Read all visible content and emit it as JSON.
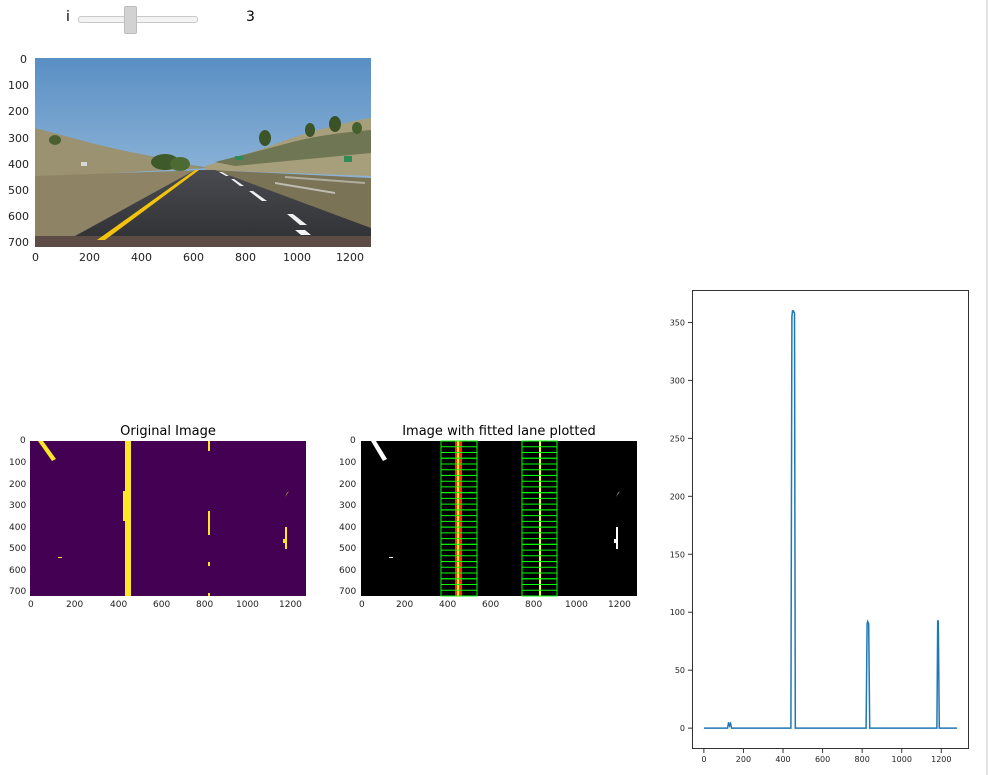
{
  "widget": {
    "label": "i",
    "value": "3"
  },
  "figure1": {
    "xticks": [
      "0",
      "200",
      "400",
      "600",
      "800",
      "1000",
      "1200"
    ],
    "yticks": [
      "0",
      "100",
      "200",
      "300",
      "400",
      "500",
      "600",
      "700"
    ]
  },
  "figure2": {
    "left_title": "Original Image",
    "right_title": "Image with fitted lane plotted",
    "xticks": [
      "0",
      "200",
      "400",
      "600",
      "800",
      "1000",
      "1200"
    ],
    "yticks": [
      "0",
      "100",
      "200",
      "300",
      "400",
      "500",
      "600",
      "700"
    ]
  },
  "chart_data": {
    "type": "line",
    "title": "",
    "xlabel": "",
    "ylabel": "",
    "xlim": [
      -60,
      1340
    ],
    "ylim": [
      -18,
      378
    ],
    "xticks": [
      "0",
      "200",
      "400",
      "600",
      "800",
      "1000",
      "1200"
    ],
    "yticks": [
      "0",
      "50",
      "100",
      "150",
      "200",
      "250",
      "300",
      "350"
    ],
    "series": [
      {
        "color": "#1f77b4",
        "x": [
          0,
          120,
          125,
          130,
          135,
          140,
          150,
          440,
          445,
          448,
          452,
          458,
          462,
          820,
          825,
          828,
          833,
          838,
          1178,
          1182,
          1185,
          1190,
          1280
        ],
        "y": [
          0,
          0,
          5,
          2,
          4,
          0,
          0,
          0,
          355,
          360,
          360,
          358,
          0,
          0,
          90,
          92,
          90,
          0,
          0,
          93,
          92,
          0,
          0
        ]
      }
    ]
  }
}
